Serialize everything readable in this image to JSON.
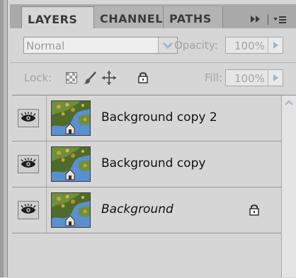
{
  "tabs": [
    {
      "label": "LAYERS"
    },
    {
      "label": "CHANNEL"
    },
    {
      "label": "PATHS"
    }
  ],
  "tab_menu": {
    "label": "▸▸ | ▾≡"
  },
  "blend": {
    "value": "Normal",
    "opacity_label": "Opacity:",
    "opacity_value": "100%"
  },
  "lock": {
    "label": "Lock:",
    "fill_label": "Fill:",
    "fill_value": "100%"
  },
  "layers": [
    {
      "name": "Background copy 2",
      "visible": true,
      "locked": false,
      "italic": false
    },
    {
      "name": "Background copy",
      "visible": true,
      "locked": false,
      "italic": false
    },
    {
      "name": "Background",
      "visible": true,
      "locked": true,
      "italic": true
    }
  ],
  "icons": {
    "visibility": "eye-icon",
    "lock": "padlock-icon",
    "lock_transparent": "checkerboard-icon",
    "lock_pixels": "brush-icon",
    "lock_position": "move-icon",
    "lock_all": "padlock-icon",
    "scroll_up": "chevron-up-icon",
    "panel_menu": "panel-menu-icon"
  },
  "colors": {
    "panel": "#d6d6d6",
    "tabbar": "#a9a9a9",
    "text_disabled": "#a3a3a3"
  }
}
